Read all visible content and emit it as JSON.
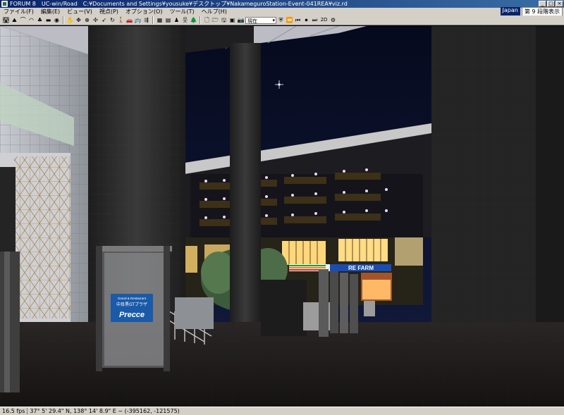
{
  "window": {
    "app_name": "FORUM 8",
    "product": "UC-win/Road",
    "file_path": "C:¥Documents and Settings¥yousuke¥デスクトップ¥NakameguroStation-Event-041REA¥viz.rd"
  },
  "menu": {
    "items": [
      "ファイル(F)",
      "編集(E)",
      "ビュー(V)",
      "視点(P)",
      "オプション(O)",
      "ツール(T)",
      "ヘルプ(H)"
    ],
    "language": "Japan",
    "mode_label": "第 9 段階表示"
  },
  "toolbar": {
    "viewpoint_select": "現在",
    "mode_2d": "2D"
  },
  "status": {
    "fps": "16.5 fps",
    "coordinates": "37° 5' 29.4\" N, 138° 14' 8.9\" E ~ (-395162, -121575)"
  },
  "scene": {
    "sign_line1": "Grand & Restaurant",
    "sign_line2": "中目黒GTプラザ",
    "sign_brand": "Precce",
    "store_sign": "RE FARM",
    "colors": {
      "sky": "#0b1330",
      "building": "#2a2a2a",
      "ground": "#1a1717",
      "warm_light": "#ffcc66",
      "sign_blue": "#1a5aa8"
    }
  }
}
